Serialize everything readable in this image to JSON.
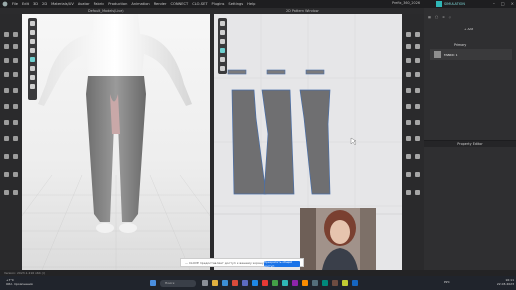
{
  "app": {
    "menu": [
      "File",
      "Edit",
      "3D",
      "2D",
      "Materials/UV",
      "Avatar",
      "Fabric",
      "Production",
      "Animation",
      "Render",
      "CONNECT",
      "CLO-SET",
      "Plugins",
      "Settings",
      "Help"
    ],
    "window_title": "Prefix_360_2026",
    "brand": "SIMULATION",
    "accent": "#2fb7b7"
  },
  "views": {
    "view3d_title": "Default_Models(Live)",
    "view2d_title": "2D Pattern Window"
  },
  "object_browser": {
    "title": "Object Browser",
    "add_label": "+ Add",
    "primary_label": "Primary",
    "fabric_name": "FABRIC 1"
  },
  "property_editor": {
    "title": "Property Editor"
  },
  "notice": {
    "text": "— CLOVE предоставляет доступ к вашему экрану",
    "button": "Прекратить общий доступ"
  },
  "statusbar": {
    "text": "Version: 2023.1.216 x64 (r)"
  },
  "taskbar": {
    "weather_temp": "+7°C",
    "weather_desc": "Обл. прояснения",
    "search": "Поиск",
    "tray_lang": "РУС",
    "time": "16:11",
    "date": "22.03.2023"
  }
}
